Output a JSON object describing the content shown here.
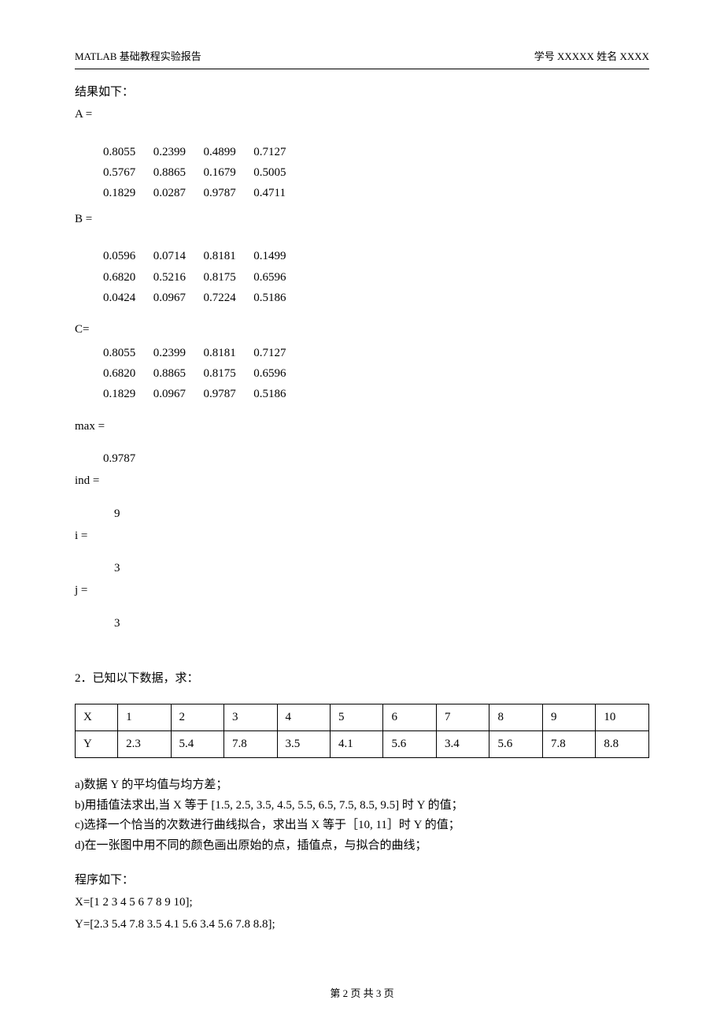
{
  "header": {
    "left": "MATLAB 基础教程实验报告",
    "right": "学号 XXXXX  姓名  XXXX"
  },
  "results": {
    "title": "结果如下：",
    "A_label": "A =",
    "A": [
      [
        "0.8055",
        "0.2399",
        "0.4899",
        "0.7127"
      ],
      [
        "0.5767",
        "0.8865",
        "0.1679",
        "0.5005"
      ],
      [
        "0.1829",
        "0.0287",
        "0.9787",
        "0.4711"
      ]
    ],
    "B_label": "B =",
    "B": [
      [
        "0.0596",
        "0.0714",
        "0.8181",
        "0.1499"
      ],
      [
        "0.6820",
        "0.5216",
        "0.8175",
        "0.6596"
      ],
      [
        "0.0424",
        "0.0967",
        "0.7224",
        "0.5186"
      ]
    ],
    "C_label": "C=",
    "C": [
      [
        "0.8055",
        "0.2399",
        "0.8181",
        "0.7127"
      ],
      [
        "0.6820",
        "0.8865",
        "0.8175",
        "0.6596"
      ],
      [
        "0.1829",
        "0.0967",
        "0.9787",
        "0.5186"
      ]
    ],
    "max_label": "max =",
    "max_val": "0.9787",
    "ind_label": "ind =",
    "ind_val": "9",
    "i_label": "i =",
    "i_val": "3",
    "j_label": "j =",
    "j_val": "3"
  },
  "q2": {
    "title": "2．已知以下数据，求：",
    "table": {
      "header": [
        "X",
        "1",
        "2",
        "3",
        "4",
        "5",
        "6",
        "7",
        "8",
        "9",
        "10"
      ],
      "row": [
        "Y",
        "2.3",
        "5.4",
        "7.8",
        "3.5",
        "4.1",
        "5.6",
        "3.4",
        "5.6",
        "7.8",
        "8.8"
      ]
    },
    "items": {
      "a": "a)数据 Y 的平均值与均方差；",
      "b": "b)用插值法求出,当 X 等于  [1.5, 2.5, 3.5, 4.5, 5.5, 6.5, 7.5, 8.5, 9.5]  时  Y 的值；",
      "c": "c)选择一个恰当的次数进行曲线拟合，求出当 X 等于［10, 11］时 Y 的值；",
      "d": "d)在一张图中用不同的颜色画出原始的点，插值点，与拟合的曲线；"
    },
    "program": {
      "label": "程序如下：",
      "l1": "X=[1 2 3 4 5 6 7 8 9 10];",
      "l2": "Y=[2.3 5.4 7.8 3.5 4.1 5.6 3.4 5.6 7.8 8.8];"
    }
  },
  "footer": "第 2 页 共 3 页"
}
